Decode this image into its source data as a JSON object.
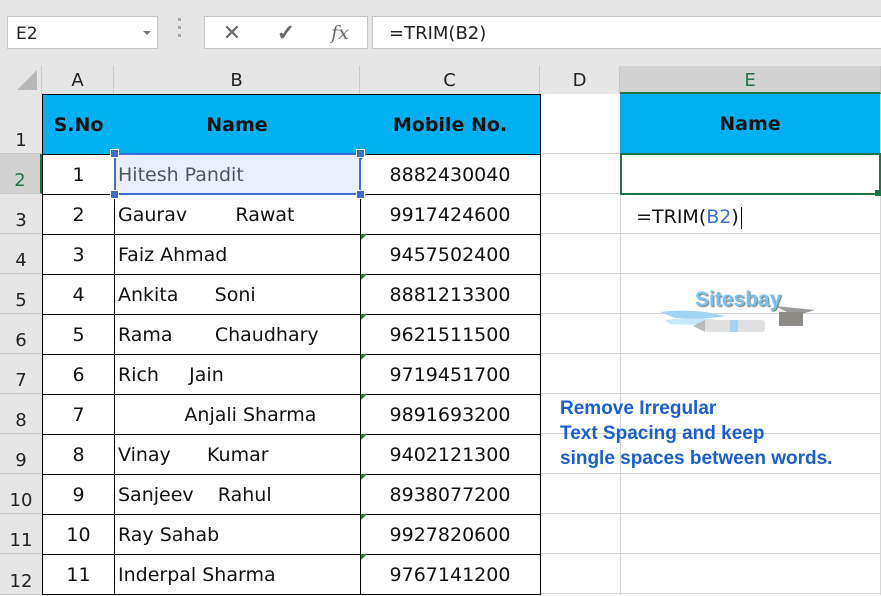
{
  "formula_bar": {
    "name_box": "E2",
    "cancel_icon": "✕",
    "enter_icon": "✓",
    "fx_label": "fx",
    "formula": "=TRIM(B2)"
  },
  "columns": [
    "A",
    "B",
    "C",
    "D",
    "E"
  ],
  "selected_column": "E",
  "rows": [
    "1",
    "2",
    "3",
    "4",
    "5",
    "6",
    "7",
    "8",
    "9",
    "10",
    "11",
    "12"
  ],
  "selected_row": "2",
  "table": {
    "headers": {
      "sno": "S.No",
      "name": "Name",
      "mobile": "Mobile No."
    },
    "records": [
      {
        "sno": "1",
        "name": "Hitesh Pandit",
        "mobile": "8882430040"
      },
      {
        "sno": "2",
        "name": "Gaurav        Rawat",
        "mobile": "9917424600"
      },
      {
        "sno": "3",
        "name": "Faiz Ahmad",
        "mobile": "9457502400"
      },
      {
        "sno": "4",
        "name": "Ankita      Soni",
        "mobile": "8881213300"
      },
      {
        "sno": "5",
        "name": "Rama       Chaudhary",
        "mobile": "9621511500"
      },
      {
        "sno": "6",
        "name": "Rich     Jain",
        "mobile": "9719451700"
      },
      {
        "sno": "7",
        "name": "           Anjali Sharma",
        "mobile": "9891693200"
      },
      {
        "sno": "8",
        "name": "Vinay      Kumar",
        "mobile": "9402121300"
      },
      {
        "sno": "9",
        "name": "Sanjeev    Rahul",
        "mobile": "8938077200"
      },
      {
        "sno": "10",
        "name": "Ray Sahab",
        "mobile": "9927820600"
      },
      {
        "sno": "11",
        "name": "Inderpal Sharma",
        "mobile": "9767141200"
      }
    ]
  },
  "result_column": {
    "header": "Name",
    "editing_cell": {
      "prefix": "=TRIM(",
      "ref": "B2",
      "suffix": ")"
    }
  },
  "watermark": "Sitesbay",
  "note": {
    "lines": [
      "Remove Irregular",
      "Text Spacing and keep",
      "single spaces between words."
    ]
  },
  "colors": {
    "header_fill": "#00b0f0",
    "selection_green": "#217346",
    "ref_blue": "#3a6fd8",
    "note_blue": "#1a5fd0"
  }
}
